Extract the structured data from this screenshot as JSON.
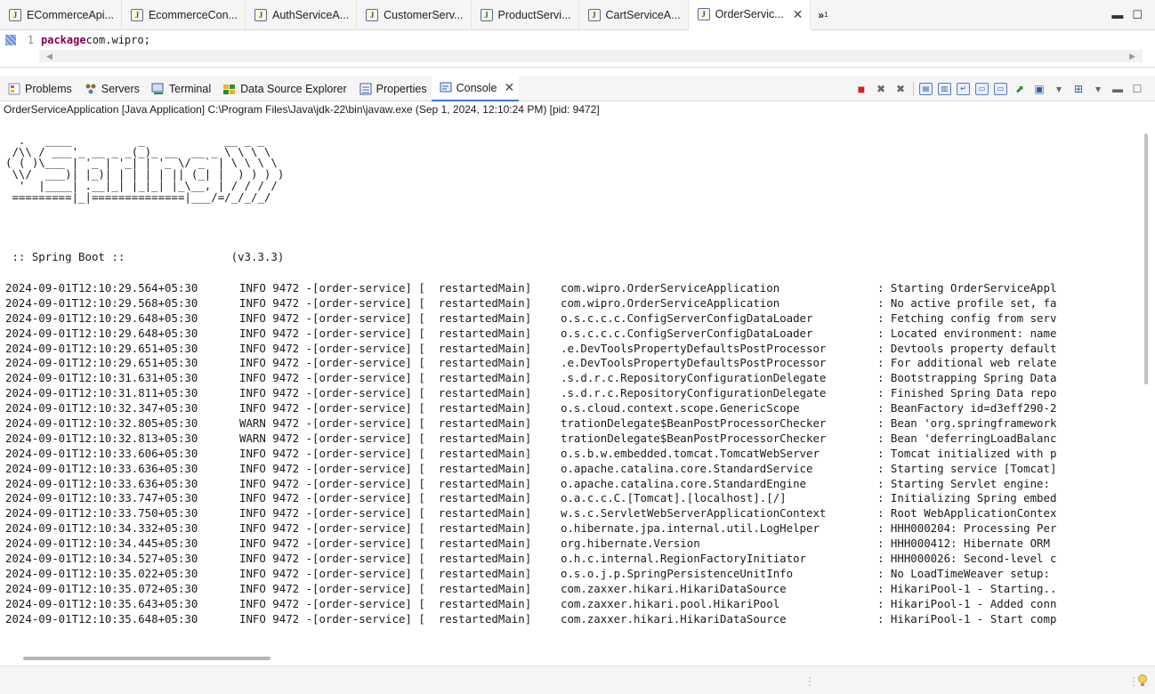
{
  "editor_tabs": [
    {
      "label": "ECommerceApi..."
    },
    {
      "label": "EcommerceCon..."
    },
    {
      "label": "AuthServiceA..."
    },
    {
      "label": "CustomerServ..."
    },
    {
      "label": "ProductServi..."
    },
    {
      "label": "CartServiceA..."
    },
    {
      "label": "OrderServic..."
    }
  ],
  "overflow": {
    "label": "»",
    "count": "1"
  },
  "editor": {
    "line_number": "1",
    "keyword": "package",
    "text": " com.wipro;"
  },
  "view_tabs": [
    {
      "label": "Problems",
      "icon": "problems-icon"
    },
    {
      "label": "Servers",
      "icon": "servers-icon"
    },
    {
      "label": "Terminal",
      "icon": "terminal-icon"
    },
    {
      "label": "Data Source Explorer",
      "icon": "data-source-icon"
    },
    {
      "label": "Properties",
      "icon": "properties-icon"
    },
    {
      "label": "Console",
      "icon": "console-icon"
    }
  ],
  "process_label": "OrderServiceApplication [Java Application] C:\\Program Files\\Java\\jdk-22\\bin\\javaw.exe  (Sep 1, 2024, 12:10:24 PM) [pid: 9472]",
  "console": {
    "banner": "  .   ____          _            __ _ _\n /\\\\ / ___'_ __ _ _(_)_ __  __ _ \\ \\ \\ \\\n( ( )\\___ | '_ | '_| | '_ \\/ _` | \\ \\ \\ \\\n \\\\/  ___)| |_)| | | | | || (_| |  ) ) ) )\n  '  |____| .__|_| |_|_| |_\\__, | / / / /\n =========|_|==============|___/=/_/_/_/",
    "boot_line": " :: Spring Boot ::                (v3.3.3)",
    "logs": [
      {
        "ts": "2024-09-01T12:10:29.564+05:30",
        "lvl": "INFO 9472 ---",
        "thr": "[order-service] [  restartedMain]",
        "cls": "com.wipro.OrderServiceApplication",
        "msg": ": Starting OrderServiceAppl"
      },
      {
        "ts": "2024-09-01T12:10:29.568+05:30",
        "lvl": "INFO 9472 ---",
        "thr": "[order-service] [  restartedMain]",
        "cls": "com.wipro.OrderServiceApplication",
        "msg": ": No active profile set, fa"
      },
      {
        "ts": "2024-09-01T12:10:29.648+05:30",
        "lvl": "INFO 9472 ---",
        "thr": "[order-service] [  restartedMain]",
        "cls": "o.s.c.c.c.ConfigServerConfigDataLoader",
        "msg": ": Fetching config from serv"
      },
      {
        "ts": "2024-09-01T12:10:29.648+05:30",
        "lvl": "INFO 9472 ---",
        "thr": "[order-service] [  restartedMain]",
        "cls": "o.s.c.c.c.ConfigServerConfigDataLoader",
        "msg": ": Located environment: name"
      },
      {
        "ts": "2024-09-01T12:10:29.651+05:30",
        "lvl": "INFO 9472 ---",
        "thr": "[order-service] [  restartedMain]",
        "cls": ".e.DevToolsPropertyDefaultsPostProcessor",
        "msg": ": Devtools property default"
      },
      {
        "ts": "2024-09-01T12:10:29.651+05:30",
        "lvl": "INFO 9472 ---",
        "thr": "[order-service] [  restartedMain]",
        "cls": ".e.DevToolsPropertyDefaultsPostProcessor",
        "msg": ": For additional web relate"
      },
      {
        "ts": "2024-09-01T12:10:31.631+05:30",
        "lvl": "INFO 9472 ---",
        "thr": "[order-service] [  restartedMain]",
        "cls": ".s.d.r.c.RepositoryConfigurationDelegate",
        "msg": ": Bootstrapping Spring Data"
      },
      {
        "ts": "2024-09-01T12:10:31.811+05:30",
        "lvl": "INFO 9472 ---",
        "thr": "[order-service] [  restartedMain]",
        "cls": ".s.d.r.c.RepositoryConfigurationDelegate",
        "msg": ": Finished Spring Data repo"
      },
      {
        "ts": "2024-09-01T12:10:32.347+05:30",
        "lvl": "INFO 9472 ---",
        "thr": "[order-service] [  restartedMain]",
        "cls": "o.s.cloud.context.scope.GenericScope",
        "msg": ": BeanFactory id=d3eff290-2"
      },
      {
        "ts": "2024-09-01T12:10:32.805+05:30",
        "lvl": "WARN 9472 ---",
        "thr": "[order-service] [  restartedMain]",
        "cls": "trationDelegate$BeanPostProcessorChecker",
        "msg": ": Bean 'org.springframework"
      },
      {
        "ts": "2024-09-01T12:10:32.813+05:30",
        "lvl": "WARN 9472 ---",
        "thr": "[order-service] [  restartedMain]",
        "cls": "trationDelegate$BeanPostProcessorChecker",
        "msg": ": Bean 'deferringLoadBalanc"
      },
      {
        "ts": "2024-09-01T12:10:33.606+05:30",
        "lvl": "INFO 9472 ---",
        "thr": "[order-service] [  restartedMain]",
        "cls": "o.s.b.w.embedded.tomcat.TomcatWebServer",
        "msg": ": Tomcat initialized with p"
      },
      {
        "ts": "2024-09-01T12:10:33.636+05:30",
        "lvl": "INFO 9472 ---",
        "thr": "[order-service] [  restartedMain]",
        "cls": "o.apache.catalina.core.StandardService",
        "msg": ": Starting service [Tomcat]"
      },
      {
        "ts": "2024-09-01T12:10:33.636+05:30",
        "lvl": "INFO 9472 ---",
        "thr": "[order-service] [  restartedMain]",
        "cls": "o.apache.catalina.core.StandardEngine",
        "msg": ": Starting Servlet engine: "
      },
      {
        "ts": "2024-09-01T12:10:33.747+05:30",
        "lvl": "INFO 9472 ---",
        "thr": "[order-service] [  restartedMain]",
        "cls": "o.a.c.c.C.[Tomcat].[localhost].[/]",
        "msg": ": Initializing Spring embed"
      },
      {
        "ts": "2024-09-01T12:10:33.750+05:30",
        "lvl": "INFO 9472 ---",
        "thr": "[order-service] [  restartedMain]",
        "cls": "w.s.c.ServletWebServerApplicationContext",
        "msg": ": Root WebApplicationContex"
      },
      {
        "ts": "2024-09-01T12:10:34.332+05:30",
        "lvl": "INFO 9472 ---",
        "thr": "[order-service] [  restartedMain]",
        "cls": "o.hibernate.jpa.internal.util.LogHelper",
        "msg": ": HHH000204: Processing Per"
      },
      {
        "ts": "2024-09-01T12:10:34.445+05:30",
        "lvl": "INFO 9472 ---",
        "thr": "[order-service] [  restartedMain]",
        "cls": "org.hibernate.Version",
        "msg": ": HHH000412: Hibernate ORM "
      },
      {
        "ts": "2024-09-01T12:10:34.527+05:30",
        "lvl": "INFO 9472 ---",
        "thr": "[order-service] [  restartedMain]",
        "cls": "o.h.c.internal.RegionFactoryInitiator",
        "msg": ": HHH000026: Second-level c"
      },
      {
        "ts": "2024-09-01T12:10:35.022+05:30",
        "lvl": "INFO 9472 ---",
        "thr": "[order-service] [  restartedMain]",
        "cls": "o.s.o.j.p.SpringPersistenceUnitInfo",
        "msg": ": No LoadTimeWeaver setup: "
      },
      {
        "ts": "2024-09-01T12:10:35.072+05:30",
        "lvl": "INFO 9472 ---",
        "thr": "[order-service] [  restartedMain]",
        "cls": "com.zaxxer.hikari.HikariDataSource",
        "msg": ": HikariPool-1 - Starting.."
      },
      {
        "ts": "2024-09-01T12:10:35.643+05:30",
        "lvl": "INFO 9472 ---",
        "thr": "[order-service] [  restartedMain]",
        "cls": "com.zaxxer.hikari.pool.HikariPool",
        "msg": ": HikariPool-1 - Added conn"
      },
      {
        "ts": "2024-09-01T12:10:35.648+05:30",
        "lvl": "INFO 9472 ---",
        "thr": "[order-service] [  restartedMain]",
        "cls": "com.zaxxer.hikari.HikariDataSource",
        "msg": ": HikariPool-1 - Start comp"
      }
    ]
  },
  "colors": {
    "accent": "#3b78d4",
    "terminate": "#d62020",
    "keyword": "#7f0055"
  }
}
